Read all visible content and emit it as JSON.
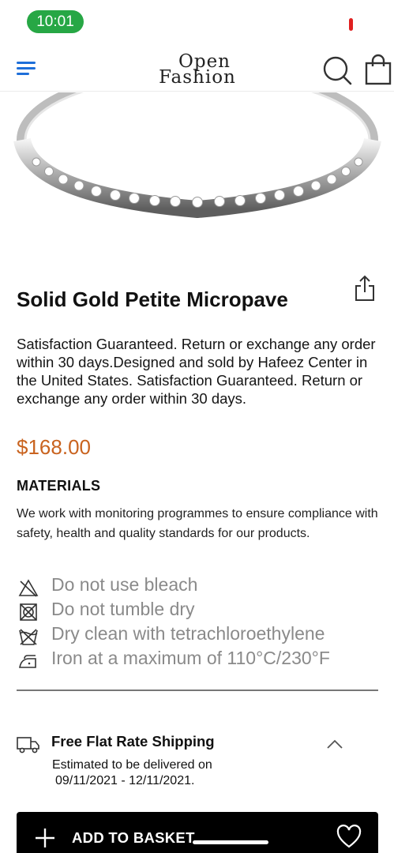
{
  "status_bar": {
    "time": "10:01"
  },
  "header": {
    "logo_line1": "Open",
    "logo_line2": "Fashion",
    "icons": [
      "menu-icon",
      "search-icon",
      "shopping-bag-icon"
    ]
  },
  "product": {
    "image": "diamond-ring-photo",
    "title": "Solid Gold Petite Micropave",
    "description": "Satisfaction Guaranteed. Return or exchange any order within 30 days.Designed and sold by Hafeez Center in the United States. Satisfaction Guaranteed. Return or exchange any order within 30 days.",
    "price": "$168.00",
    "price_color": "#c9631f"
  },
  "materials": {
    "title": "MATERIALS",
    "text": "We work with monitoring programmes to ensure compliance with safety, health and quality standards for our products.",
    "care": [
      {
        "icon": "no-bleach-icon",
        "label": "Do not use bleach"
      },
      {
        "icon": "no-tumble-dry-icon",
        "label": "Do not tumble dry"
      },
      {
        "icon": "dry-clean-icon",
        "label": "Dry clean with tetrachloroethylene"
      },
      {
        "icon": "iron-icon",
        "label": "Iron at a maximum of 110°C/230°F"
      }
    ]
  },
  "shipping": {
    "title": "Free Flat Rate Shipping",
    "line1": "Estimated to be delivered on",
    "line2": "09/11/2021 - 12/11/2021."
  },
  "basket": {
    "label": "ADD TO BASKET"
  },
  "colors": {
    "accent_menu": "#1e6fd9",
    "status_green": "#27a745",
    "button_bg": "#000000"
  }
}
